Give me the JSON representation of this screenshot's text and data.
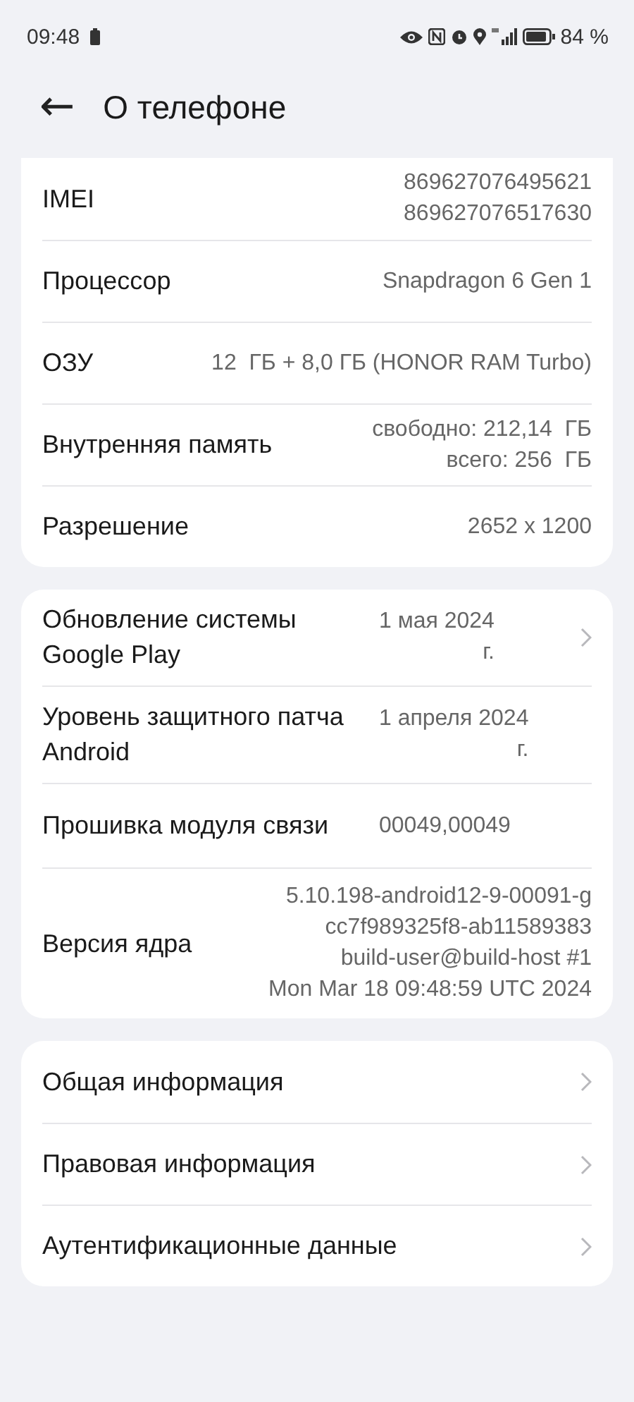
{
  "status_bar": {
    "time": "09:48",
    "battery": "84 %"
  },
  "header": {
    "back": "←",
    "title": "О телефоне"
  },
  "cards": [
    {
      "rows": [
        {
          "label": "IMEI",
          "value_lines": [
            "869627076495621",
            "869627076517630"
          ],
          "chevron": false
        },
        {
          "label": "Процессор",
          "value_lines": [
            "Snapdragon 6 Gen 1"
          ],
          "chevron": false
        },
        {
          "label": "ОЗУ",
          "value_lines": [
            "12  ГБ + 8,0 ГБ (HONOR RAM Turbo)"
          ],
          "chevron": false
        },
        {
          "label": "Внутренняя память",
          "value_lines": [
            "свободно: 212,14  ГБ",
            "всего: 256  ГБ"
          ],
          "chevron": false
        },
        {
          "label": "Разрешение",
          "value_lines": [
            "2652 x 1200"
          ],
          "chevron": false
        }
      ]
    },
    {
      "rows": [
        {
          "label": "Обновление системы Google Play",
          "value_lines": [
            "1 мая 2024",
            "г."
          ],
          "chevron": true
        },
        {
          "label": "Уровень защитного патча Android",
          "value_lines": [
            "1 апреля 2024",
            "г."
          ],
          "chevron": false
        },
        {
          "label": "Прошивка модуля связи",
          "value_lines": [
            "00049,00049"
          ],
          "chevron": false
        },
        {
          "label": "Версия ядра",
          "value_lines": [
            "5.10.198-android12-9-00091-g",
            "cc7f989325f8-ab11589383",
            "build-user@build-host #1",
            "Mon Mar 18 09:48:59 UTC 2024"
          ],
          "chevron": false
        }
      ]
    },
    {
      "rows": [
        {
          "label": "Общая информация",
          "chevron": true
        },
        {
          "label": "Правовая информация",
          "chevron": true
        },
        {
          "label": "Аутентификационные данные",
          "chevron": true
        }
      ]
    }
  ]
}
